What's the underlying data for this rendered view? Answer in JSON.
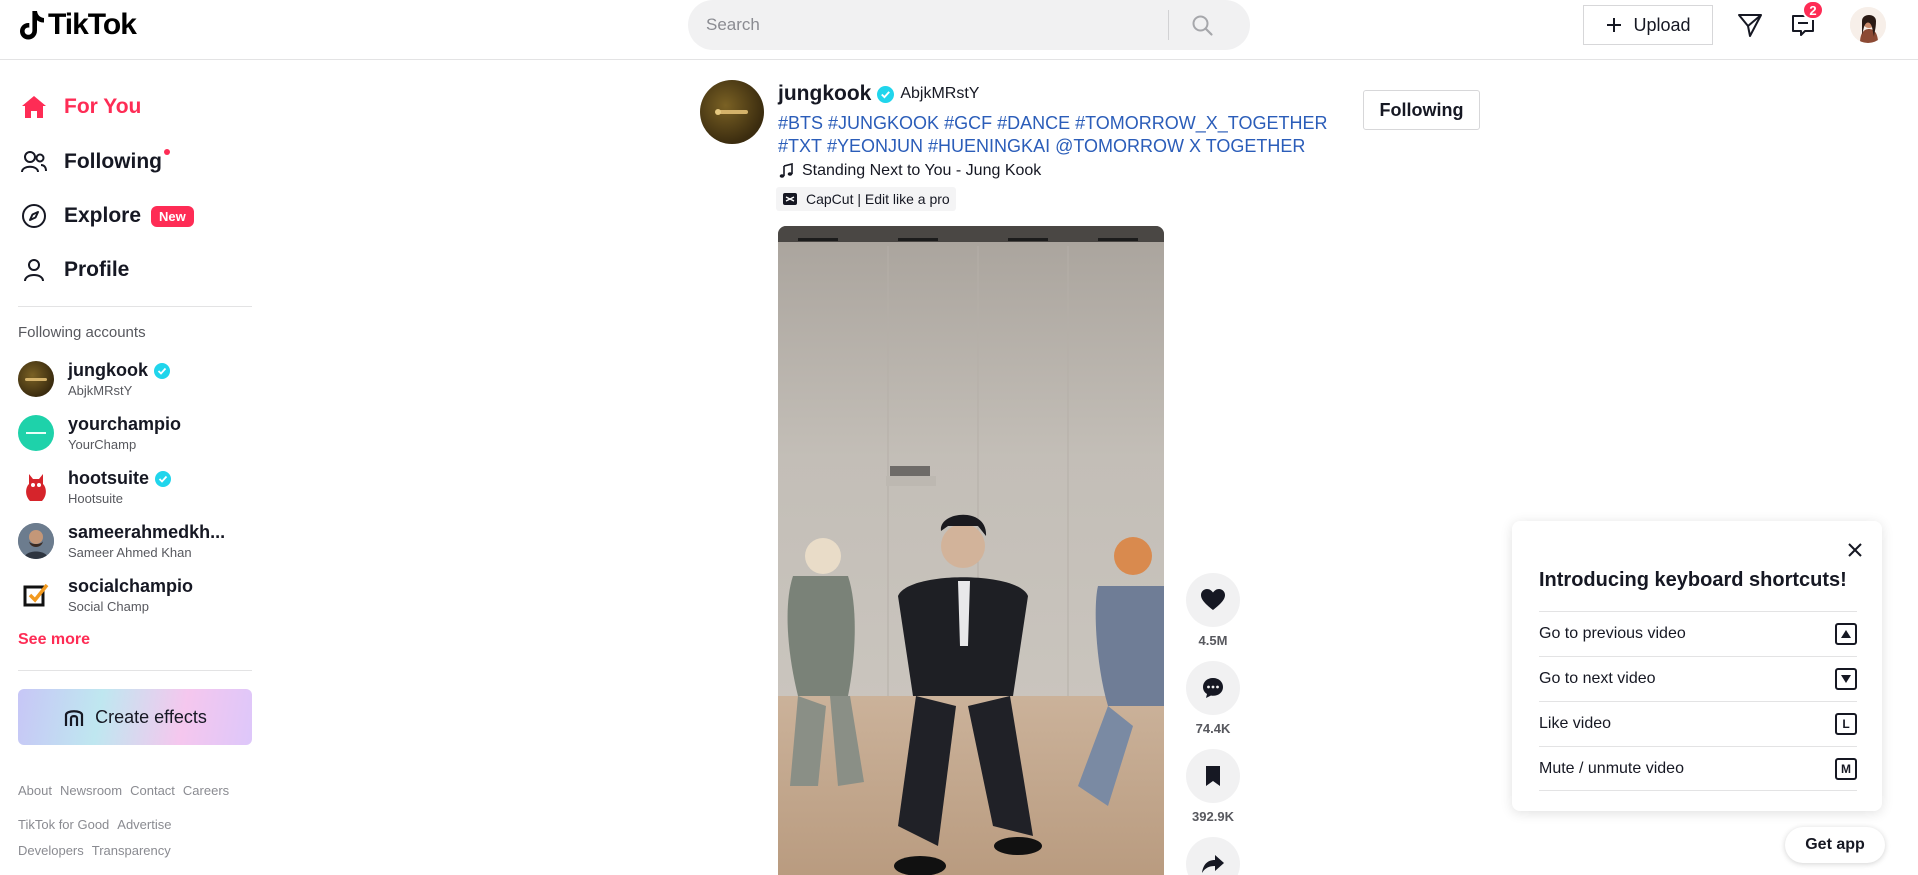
{
  "header": {
    "logo_text": "TikTok",
    "search_placeholder": "Search",
    "upload_label": "Upload",
    "notification_count": "2",
    "brand_color": "#fe2c55"
  },
  "sidebar": {
    "nav": [
      {
        "label": "For You",
        "icon": "home-icon",
        "active": true
      },
      {
        "label": "Following",
        "icon": "following-icon",
        "active": false
      },
      {
        "label": "Explore",
        "icon": "compass-icon",
        "badge": "New",
        "active": false
      },
      {
        "label": "Profile",
        "icon": "person-icon",
        "active": false
      }
    ],
    "following_title": "Following accounts",
    "accounts": [
      {
        "name": "jungkook",
        "nick": "AbjkMRstY",
        "verified": true
      },
      {
        "name": "yourchampio",
        "nick": "YourChamp",
        "verified": false
      },
      {
        "name": "hootsuite",
        "nick": "Hootsuite",
        "verified": true
      },
      {
        "name": "sameerahmedkh...",
        "nick": "Sameer Ahmed Khan",
        "verified": false
      },
      {
        "name": "socialchampio",
        "nick": "Social Champ",
        "verified": false
      }
    ],
    "see_more": "See more",
    "create_effects": "Create effects",
    "footer": [
      [
        "About",
        "Newsroom",
        "Contact",
        "Careers"
      ],
      [
        "TikTok for Good",
        "Advertise"
      ],
      [
        "Developers",
        "Transparency"
      ]
    ]
  },
  "post": {
    "author_name": "jungkook",
    "author_nick": "AbjkMRstY",
    "hashtags_line1": [
      "#BTS",
      "#JUNGKOOK",
      "#GCF",
      "#DANCE",
      "#TOMORROW_X_TOGETHER"
    ],
    "hashtags_line2": [
      "#TXT",
      "#YEONJUN",
      "#HUENINGKAI",
      "@TOMORROW X TOGETHER"
    ],
    "music": "Standing Next to You - Jung Kook",
    "capcut": "CapCut | Edit like a pro",
    "follow_label": "Following",
    "likes": "4.5M",
    "comments": "74.4K",
    "saves": "392.9K"
  },
  "shortcuts": {
    "title": "Introducing keyboard shortcuts!",
    "rows": [
      {
        "label": "Go to previous video",
        "key": "up-arrow-icon"
      },
      {
        "label": "Go to next video",
        "key": "down-arrow-icon"
      },
      {
        "label": "Like video",
        "key": "L"
      },
      {
        "label": "Mute / unmute video",
        "key": "M"
      }
    ]
  },
  "get_app": "Get app"
}
